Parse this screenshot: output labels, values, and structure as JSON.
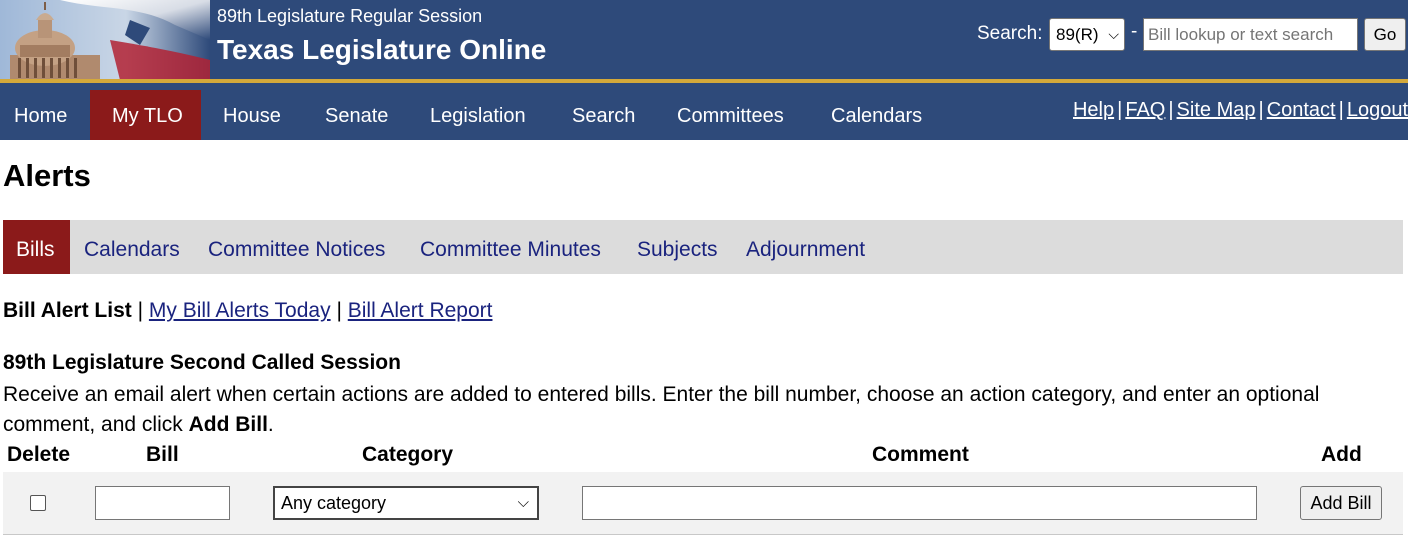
{
  "header": {
    "session_label": "89th Legislature Regular Session",
    "site_title": "Texas Legislature Online",
    "search_label": "Search:",
    "session_selected": "89(R)",
    "dash": "-",
    "search_placeholder": "Bill lookup or text search",
    "go_label": "Go"
  },
  "nav": {
    "items": [
      {
        "label": "Home",
        "active": false
      },
      {
        "label": "My TLO",
        "active": true
      },
      {
        "label": "House",
        "active": false
      },
      {
        "label": "Senate",
        "active": false
      },
      {
        "label": "Legislation",
        "active": false
      },
      {
        "label": "Search",
        "active": false
      },
      {
        "label": "Committees",
        "active": false
      },
      {
        "label": "Calendars",
        "active": false
      }
    ],
    "util_links": [
      "Help",
      "FAQ",
      "Site Map",
      "Contact",
      "Logout"
    ],
    "separator": "|"
  },
  "page": {
    "title": "Alerts",
    "tabs": [
      {
        "label": "Bills",
        "active": true
      },
      {
        "label": "Calendars",
        "active": false
      },
      {
        "label": "Committee Notices",
        "active": false
      },
      {
        "label": "Committee Minutes",
        "active": false
      },
      {
        "label": "Subjects",
        "active": false
      },
      {
        "label": "Adjournment",
        "active": false
      }
    ],
    "sublinks": {
      "current": "Bill Alert List",
      "links": [
        "My Bill Alerts Today",
        "Bill Alert Report"
      ],
      "separator": "|"
    },
    "session_heading": "89th Legislature Second Called Session",
    "instructions_text": "Receive an email alert when certain actions are added to entered bills. Enter the bill number, choose an action category, and enter an optional comment, and click ",
    "instructions_bold": "Add Bill",
    "instructions_end": "."
  },
  "table": {
    "headers": {
      "delete": "Delete",
      "bill": "Bill",
      "category": "Category",
      "comment": "Comment",
      "add": "Add"
    },
    "row": {
      "delete_checked": false,
      "bill_value": "",
      "category_selected": "Any category",
      "comment_value": "",
      "add_label": "Add Bill"
    }
  },
  "colors": {
    "header_blue": "#2e4a7a",
    "accent_gold": "#d4a93a",
    "active_red": "#8b1a1a",
    "link_navy": "#1a237e",
    "tab_bar_gray": "#dcdcdc"
  }
}
